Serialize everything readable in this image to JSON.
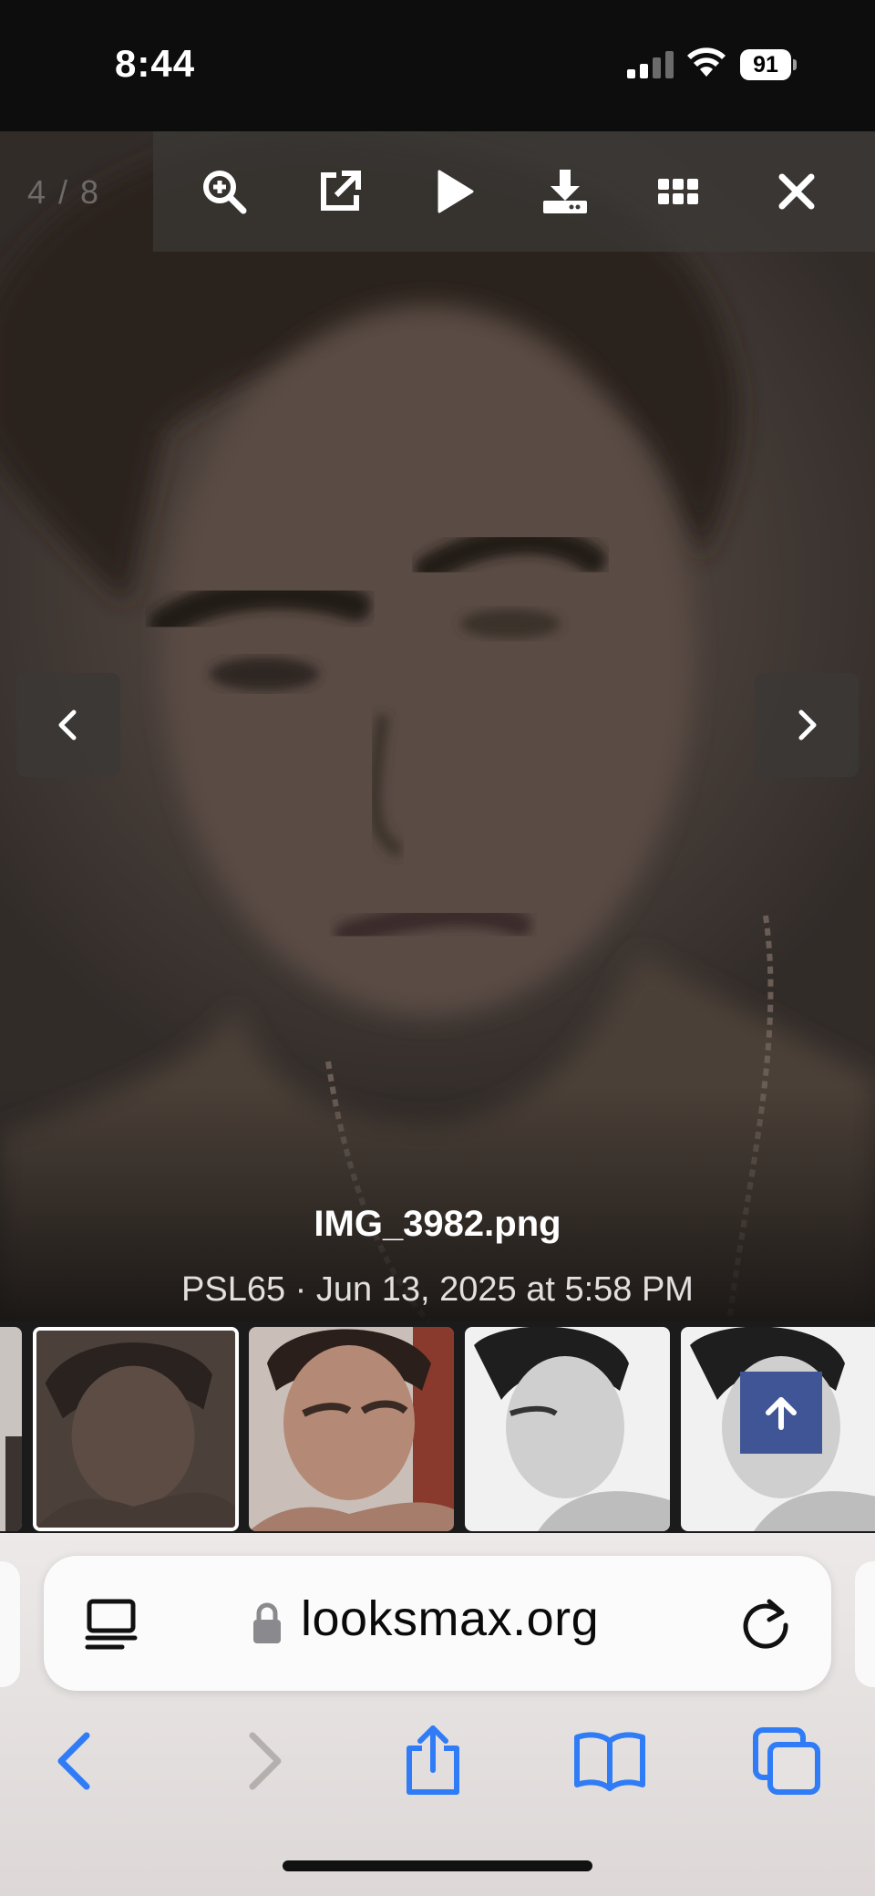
{
  "status_bar": {
    "time": "8:44",
    "battery": "91",
    "icons": [
      "cellular-signal-icon",
      "wifi-icon",
      "battery-icon"
    ]
  },
  "lightbox": {
    "counter": "4 / 8",
    "toolbar": {
      "icons": [
        "zoom-in-icon",
        "open-external-icon",
        "play-slideshow-icon",
        "download-icon",
        "thumbnails-grid-icon",
        "close-icon"
      ]
    },
    "nav": {
      "prev_icon": "chevron-left-icon",
      "next_icon": "chevron-right-icon"
    },
    "caption": {
      "title": "IMG_3982.png",
      "meta": "PSL65 · Jun 13, 2025 at 5:58 PM"
    },
    "thumbnails_count_visible": 5,
    "active_thumbnail": 1,
    "scroll_top_icon": "arrow-up-icon"
  },
  "browser": {
    "url": "looksmax.org",
    "reader_icon": "reader-mode-icon",
    "lock_icon": "lock-icon",
    "reload_icon": "reload-icon",
    "toolbar": [
      "back-icon",
      "forward-icon",
      "share-icon",
      "bookmarks-icon",
      "tabs-icon"
    ],
    "accent": "#2f7cf6"
  }
}
